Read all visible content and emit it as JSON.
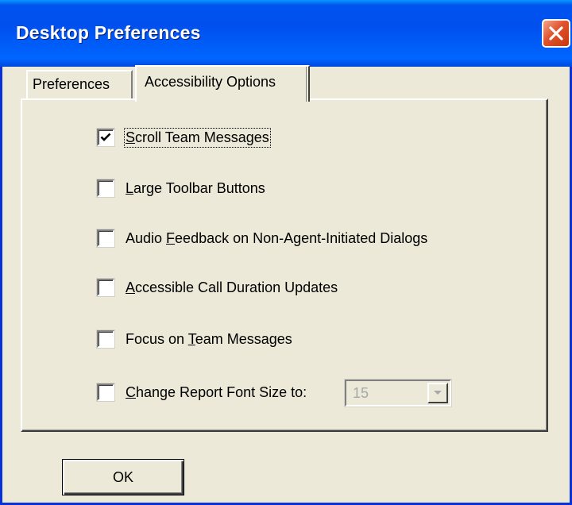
{
  "window": {
    "title": "Desktop Preferences",
    "title_bar_color": "#0053ee",
    "background_color": "#ece9d8"
  },
  "tabs": [
    {
      "label": "Preferences",
      "active": false
    },
    {
      "label": "Accessibility Options",
      "active": true
    }
  ],
  "options": [
    {
      "pre": "",
      "mnemonic": "S",
      "post": "croll Team Messages",
      "checked": true,
      "focused": true
    },
    {
      "pre": "",
      "mnemonic": "L",
      "post": "arge Toolbar Buttons",
      "checked": false
    },
    {
      "pre": "Audio ",
      "mnemonic": "F",
      "post": "eedback on Non-Agent-Initiated Dialogs",
      "checked": false
    },
    {
      "pre": "",
      "mnemonic": "A",
      "post": "ccessible Call Duration Updates",
      "checked": false
    },
    {
      "pre": "Focus on ",
      "mnemonic": "T",
      "post": "eam Messages",
      "checked": false
    },
    {
      "pre": "",
      "mnemonic": "C",
      "post": "hange Report Font Size to:",
      "checked": false
    }
  ],
  "font_size_select": {
    "value": "15",
    "disabled": true
  },
  "buttons": {
    "ok_label": "OK"
  },
  "icons": {
    "close": "close-icon",
    "check": "checkmark-icon",
    "dropdown": "chevron-down-icon"
  }
}
